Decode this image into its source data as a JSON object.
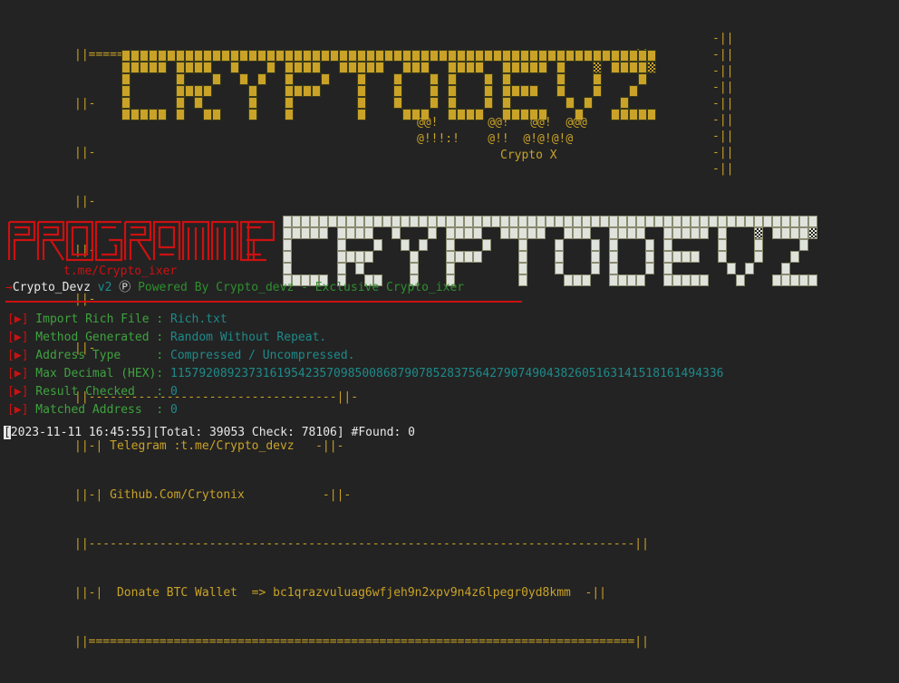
{
  "header": {
    "border_top": "||=============================================================================||",
    "border_bottom": "||=============================================================================||",
    "edge_left": "||-",
    "edge_right": "-||",
    "separator_line": "||-----------------------------------||-",
    "separator_line2": "||-----------------------------------------------------------------------------||",
    "telegram_label": "||-| Telegram :t.me/Crypto_devz   -||-",
    "github_label": "||-| Github.Com/Crytonix           -||-",
    "donate_label": "||-|  Donate BTC Wallet  => bc1qrazvuluag6wfjeh9n2xpv9n4z6lpegr0yd8kmm  -||",
    "telegram_url": "t.me/Crypto_devz",
    "github_url": "Github.Com/Crytonix",
    "donate_wallet": "bc1qrazvuluag6wfjeh9n2xpv9n4z6lpegr0yd8kmm",
    "at_art_line1": "@@!       @@!   @@!  @@@",
    "at_art_line2": "@!!!:!    @!!  @!@!@!@",
    "at_art_line3": "Crypto X",
    "banner_text": "CRYPTODEVZ"
  },
  "logo": {
    "programmer_word": "PROGRAMMER",
    "programmer_ascii": [
      "┌─┐┌─┐┌─┐┌─┐┌─┐┌─┐┌─┐┌─┐┌─┐┌─┐",
      "│ ││ ││ ││ ││ ││ ││ ││ ││ ││ │"
    ],
    "sub_url": "t.me/Crypto_ixer",
    "second_banner_text": "CRYPTODEVZ"
  },
  "status_line": {
    "arrow": "→",
    "app_name": "Crypto_Devz",
    "version": "v2",
    "registered": "Ⓟ",
    "powered_by": "Powered By Crypto_devz - Exclusive Crypto_ixer"
  },
  "info": {
    "rows": [
      {
        "bullet": "[▶]",
        "label": "Import Rich File ",
        "sep": ": ",
        "value": "Rich.txt"
      },
      {
        "bullet": "[▶]",
        "label": "Method Generated ",
        "sep": ": ",
        "value": "Random Without Repeat."
      },
      {
        "bullet": "[▶]",
        "label": "Address Type     ",
        "sep": ": ",
        "value": "Compressed / Uncompressed."
      },
      {
        "bullet": "[▶]",
        "label": "Max Decimal (HEX)",
        "sep": ": ",
        "value": "115792089237316195423570985008687907852837564279074904382605163141518161494336"
      },
      {
        "bullet": "[▶]",
        "label": "Result Checked   ",
        "sep": ": ",
        "value": "0"
      },
      {
        "bullet": "[▶]",
        "label": "Matched Address  ",
        "sep": ": ",
        "value": "0"
      }
    ]
  },
  "bottom_bar": {
    "cursor_char": "[",
    "timestamp": "2023-11-11 16:45:55",
    "total_label": "Total:",
    "total_value": "39053",
    "check_label": "Check:",
    "check_value": "78106",
    "found_label": "#Found:",
    "found_value": "0",
    "full_text": "[2023-11-11 16:45:55][Total: 39053 Check: 78106] #Found: 0"
  },
  "colors": {
    "background": "#232323",
    "gold": "#c9a227",
    "red": "#cc1111",
    "white": "#e8e8e8",
    "green": "#2f8f2f",
    "cyan": "#1f8a8a",
    "banner_light": "#dfe3dc"
  }
}
